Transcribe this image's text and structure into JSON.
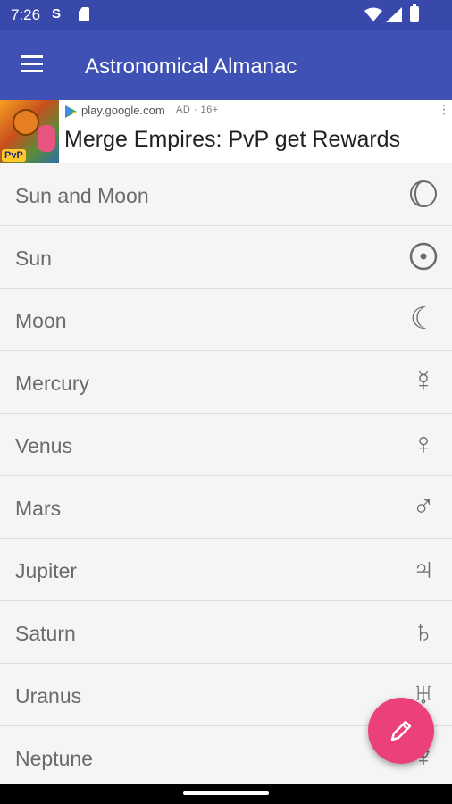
{
  "status_bar": {
    "time": "7:26",
    "icons": [
      "s-icon",
      "sd-card-icon",
      "wifi-icon",
      "signal-icon",
      "battery-icon"
    ]
  },
  "app_bar": {
    "title": "Astronomical Almanac",
    "menu_icon": "hamburger-menu-icon",
    "color": "#3f51b5"
  },
  "ad": {
    "source": "play.google.com",
    "badge": "AD · 16+",
    "headline": "Merge Empires: PvP get Rewards",
    "thumbnail_label": "PvP"
  },
  "list": {
    "items": [
      {
        "label": "Sun and Moon",
        "symbol": "sun-and-moon-icon"
      },
      {
        "label": "Sun",
        "symbol": "sun-icon"
      },
      {
        "label": "Moon",
        "symbol": "moon-icon"
      },
      {
        "label": "Mercury",
        "symbol": "mercury-icon"
      },
      {
        "label": "Venus",
        "symbol": "venus-icon"
      },
      {
        "label": "Mars",
        "symbol": "mars-icon"
      },
      {
        "label": "Jupiter",
        "symbol": "jupiter-icon"
      },
      {
        "label": "Saturn",
        "symbol": "saturn-icon"
      },
      {
        "label": "Uranus",
        "symbol": "uranus-icon"
      },
      {
        "label": "Neptune",
        "symbol": "neptune-icon"
      }
    ]
  },
  "fab": {
    "icon": "pencil-icon",
    "color": "#ec407a"
  }
}
